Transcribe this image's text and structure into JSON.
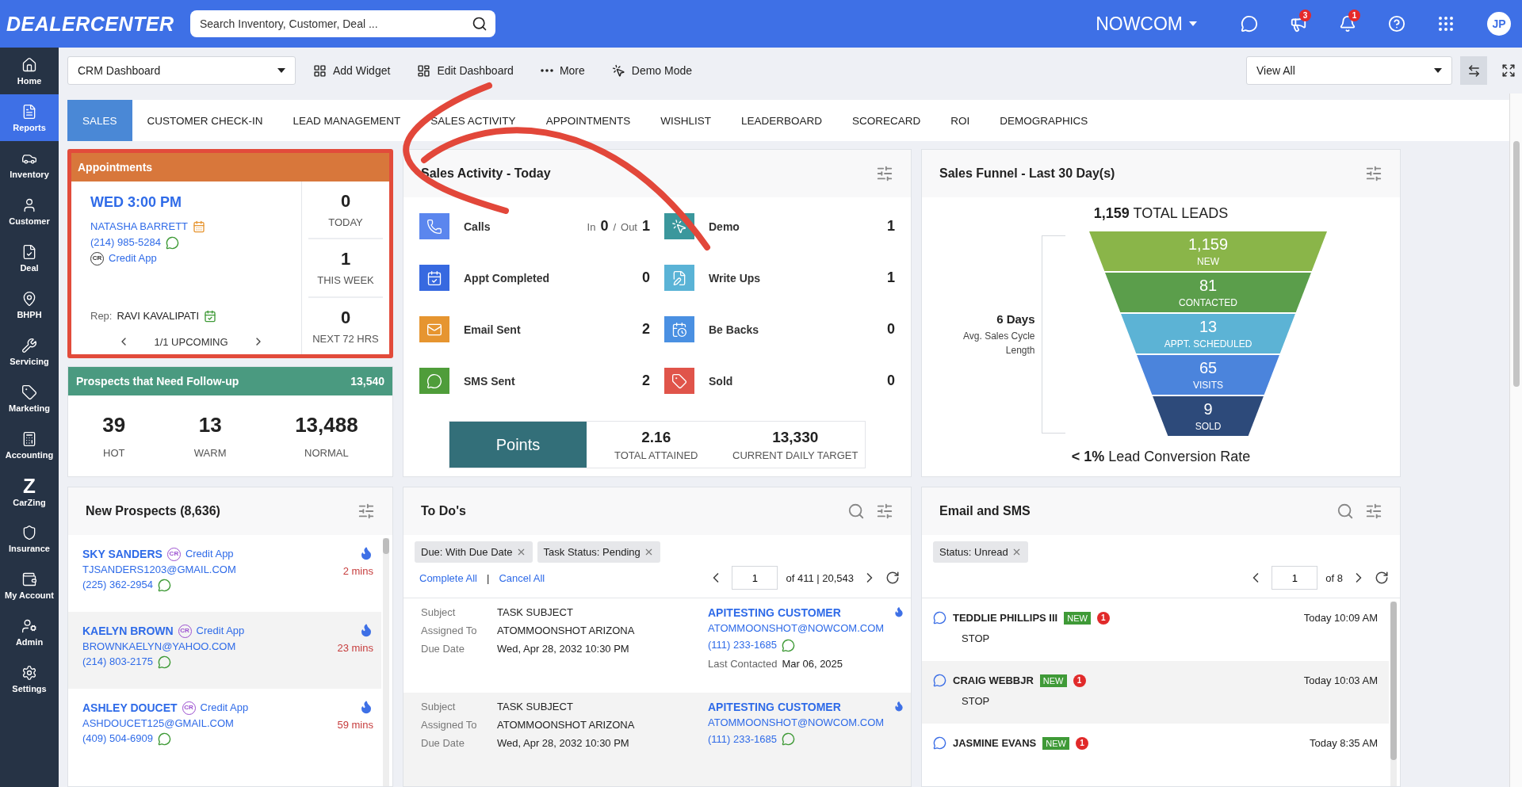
{
  "topbar": {
    "logo": "DEALERCENTER",
    "search": {
      "placeholder": "Search Inventory, Customer, Deal ..."
    },
    "company": "NOWCOM",
    "announcements_badge": "3",
    "notifications_badge": "1",
    "avatar": "JP"
  },
  "sidebar": {
    "items": [
      {
        "label": "Home",
        "selected": false
      },
      {
        "label": "Reports",
        "selected": true
      },
      {
        "label": "Inventory",
        "selected": false
      },
      {
        "label": "Customer",
        "selected": false
      },
      {
        "label": "Deal",
        "selected": false
      },
      {
        "label": "BHPH",
        "selected": false
      },
      {
        "label": "Servicing",
        "selected": false
      },
      {
        "label": "Marketing",
        "selected": false
      },
      {
        "label": "Accounting",
        "selected": false
      },
      {
        "label": "CarZing",
        "selected": false,
        "glyph": "Z"
      },
      {
        "label": "Insurance",
        "selected": false
      },
      {
        "label": "My Account",
        "selected": false
      },
      {
        "label": "Admin",
        "selected": false
      },
      {
        "label": "Settings",
        "selected": false
      }
    ]
  },
  "toolbar": {
    "dashboard_select": "CRM Dashboard",
    "actions": [
      "Add Widget",
      "Edit Dashboard",
      "More",
      "Demo Mode"
    ],
    "view_select": "View All"
  },
  "tabs": [
    {
      "label": "SALES",
      "selected": true
    },
    {
      "label": "CUSTOMER CHECK-IN",
      "selected": false
    },
    {
      "label": "LEAD MANAGEMENT",
      "selected": false
    },
    {
      "label": "SALES ACTIVITY",
      "selected": false
    },
    {
      "label": "APPOINTMENTS",
      "selected": false
    },
    {
      "label": "WISHLIST",
      "selected": false
    },
    {
      "label": "LEADERBOARD",
      "selected": false
    },
    {
      "label": "SCORECARD",
      "selected": false
    },
    {
      "label": "ROI",
      "selected": false
    },
    {
      "label": "DEMOGRAPHICS",
      "selected": false
    }
  ],
  "appointments": {
    "title": "Appointments",
    "highlighted": true,
    "time": "WED 3:00 PM",
    "customer": "NATASHA BARRETT",
    "phone": "(214) 985-5284",
    "credit_badge": "CR",
    "credit_link": "Credit App",
    "rep_label": "Rep:",
    "rep": "RAVI KAVALIPATI",
    "pager": "1/1 UPCOMING",
    "stats": [
      {
        "value": "0",
        "label": "TODAY"
      },
      {
        "value": "1",
        "label": "THIS WEEK"
      },
      {
        "value": "0",
        "label": "NEXT 72 HRS"
      }
    ]
  },
  "followup": {
    "title": "Prospects that Need Follow-up",
    "total": "13,540",
    "stats": [
      {
        "value": "39",
        "label": "HOT"
      },
      {
        "value": "13",
        "label": "WARM"
      },
      {
        "value": "13,488",
        "label": "NORMAL"
      }
    ]
  },
  "sales_activity": {
    "title": "Sales Activity - Today",
    "items": [
      {
        "kind": "inout",
        "label": "Calls",
        "in_label": "In",
        "in_value": "0",
        "separator": "/",
        "out_label": "Out",
        "out_value": "1",
        "color": "#5b86ee"
      },
      {
        "kind": "count",
        "label": "Demo",
        "value": "1",
        "color": "#3b979c"
      },
      {
        "kind": "count",
        "label": "Appt Completed",
        "value": "0",
        "color": "#3769e0"
      },
      {
        "kind": "count",
        "label": "Write Ups",
        "value": "1",
        "color": "#5ab3d6"
      },
      {
        "kind": "count",
        "label": "Email Sent",
        "value": "2",
        "color": "#e69530"
      },
      {
        "kind": "count",
        "label": "Be Backs",
        "value": "0",
        "color": "#4a90e2"
      },
      {
        "kind": "count",
        "label": "SMS Sent",
        "value": "2",
        "color": "#4f9d3a"
      },
      {
        "kind": "count",
        "label": "Sold",
        "value": "0",
        "color": "#e0544a"
      }
    ],
    "points": {
      "label": "Points",
      "stats": [
        {
          "value": "2.16",
          "label": "TOTAL ATTAINED"
        },
        {
          "value": "13,330",
          "label": "CURRENT DAILY TARGET"
        }
      ]
    }
  },
  "funnel": {
    "title": "Sales Funnel - Last 30 Day(s)",
    "total_value": "1,159",
    "total_label": "TOTAL LEADS",
    "cycle_value": "6 Days",
    "cycle_label": "Avg. Sales Cycle Length",
    "stages": [
      {
        "value": "1,159",
        "label": "NEW",
        "color": "#8ab549"
      },
      {
        "value": "81",
        "label": "CONTACTED",
        "color": "#5b9e4b"
      },
      {
        "value": "13",
        "label": "APPT. SCHEDULED",
        "color": "#5cb3d5"
      },
      {
        "value": "65",
        "label": "VISITS",
        "color": "#4b84dc"
      },
      {
        "value": "9",
        "label": "SOLD",
        "color": "#2d4a7a"
      }
    ],
    "conversion": "**< 1%** Lead Conversion Rate"
  },
  "new_prospects": {
    "title": "New Prospects (8,636)",
    "rows": [
      {
        "name": "SKY SANDERS",
        "badge": "CR",
        "link": "Credit App",
        "email": "TJSANDERS1203@GMAIL.COM",
        "phone": "(225) 362-2954",
        "age": "2 mins"
      },
      {
        "name": "KAELYN BROWN",
        "badge": "CR",
        "link": "Credit App",
        "email": "BROWNKAELYN@YAHOO.COM",
        "phone": "(214) 803-2175",
        "age": "23 mins"
      },
      {
        "name": "ASHLEY DOUCET",
        "badge": "CR",
        "link": "Credit App",
        "email": "ASHDOUCET125@GMAIL.COM",
        "phone": "(409) 504-6909",
        "age": "59 mins"
      }
    ]
  },
  "todos": {
    "title": "To Do's",
    "filters": [
      "Due: With Due Date",
      "Task Status: Pending"
    ],
    "complete_all": "Complete All",
    "divider": "|",
    "cancel_all": "Cancel All",
    "page": "1",
    "page_total": "of 411 | 20,543",
    "items": [
      {
        "fields": [
          {
            "label": "Subject",
            "value": "TASK SUBJECT"
          },
          {
            "label": "Assigned To",
            "value": "ATOMMOONSHOT ARIZONA"
          },
          {
            "label": "Due Date",
            "value": "Wed, Apr 28, 2032 10:30 PM"
          }
        ],
        "customer": "APITESTING CUSTOMER",
        "email": "ATOMMOONSHOT@NOWCOM.COM",
        "phone": "(111) 233-1685",
        "last_contacted_label": "Last Contacted",
        "last_contacted": "Mar 06, 2025"
      },
      {
        "fields": [
          {
            "label": "Subject",
            "value": "TASK SUBJECT"
          },
          {
            "label": "Assigned To",
            "value": "ATOMMOONSHOT ARIZONA"
          },
          {
            "label": "Due Date",
            "value": "Wed, Apr 28, 2032 10:30 PM"
          }
        ],
        "customer": "APITESTING CUSTOMER",
        "email": "ATOMMOONSHOT@NOWCOM.COM",
        "phone": "(111) 233-1685"
      }
    ]
  },
  "email_sms": {
    "title": "Email and SMS",
    "filters": [
      "Status: Unread"
    ],
    "page": "1",
    "page_total": "of 8",
    "messages": [
      {
        "name": "TEDDLIE PHILLIPS III",
        "tag": "NEW",
        "count": "1",
        "time": "Today 10:09 AM",
        "text": "STOP"
      },
      {
        "name": "CRAIG WEBBJR",
        "tag": "NEW",
        "count": "1",
        "time": "Today 10:03 AM",
        "text": "STOP"
      },
      {
        "name": "JASMINE EVANS",
        "tag": "NEW",
        "count": "1",
        "time": "Today 8:35 AM"
      }
    ]
  }
}
